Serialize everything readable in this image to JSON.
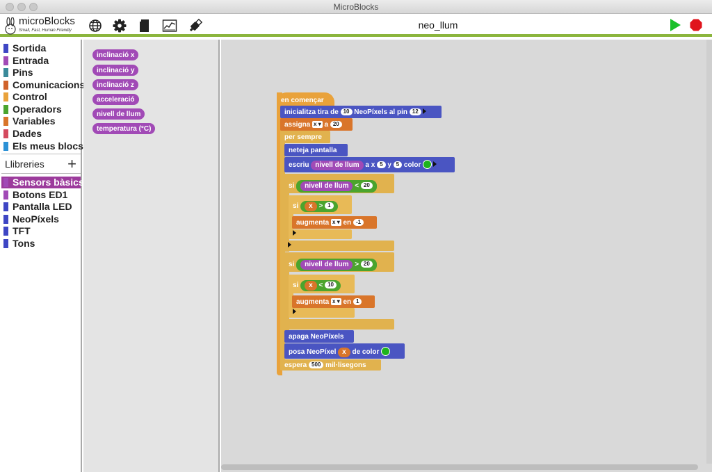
{
  "window": {
    "title": "MicroBlocks"
  },
  "toolbar": {
    "logo_text": "microBlocks",
    "tagline": "Small, Fast, Human Friendly",
    "project_name": "neo_llum",
    "icons": [
      "globe-icon",
      "gear-icon",
      "file-icon",
      "graph-icon",
      "usb-icon"
    ]
  },
  "categories": [
    {
      "label": "Sortida",
      "color": "#3e46c4"
    },
    {
      "label": "Entrada",
      "color": "#a14ab6"
    },
    {
      "label": "Pins",
      "color": "#3a8a9a"
    },
    {
      "label": "Comunicacions",
      "color": "#d0622a"
    },
    {
      "label": "Control",
      "color": "#e9a23b"
    },
    {
      "label": "Operadors",
      "color": "#4ba42d"
    },
    {
      "label": "Variables",
      "color": "#d9752a"
    },
    {
      "label": "Dades",
      "color": "#d44a5f"
    },
    {
      "label": "Els meus blocs",
      "color": "#2b91d6"
    }
  ],
  "libraries": {
    "header": "Llibreries",
    "add": "+",
    "items": [
      {
        "label": "Sensors bàsics",
        "color": "#a14ab6",
        "selected": true
      },
      {
        "label": "Botons ED1",
        "color": "#a14ab6"
      },
      {
        "label": "Pantalla LED",
        "color": "#3e46c4"
      },
      {
        "label": "NeoPíxels",
        "color": "#3e46c4"
      },
      {
        "label": "TFT",
        "color": "#3e46c4"
      },
      {
        "label": "Tons",
        "color": "#3e46c4"
      }
    ]
  },
  "palette_blocks": [
    "inclinació x",
    "inclinació y",
    "inclinació z",
    "acceleració",
    "nivell de llum",
    "temperatura (°C)"
  ],
  "script": {
    "hat": "en començar",
    "init_a": "inicialitza tira de",
    "init_n": "10",
    "init_b": "NeoPíxels al pin",
    "init_pin": "12",
    "assign": "assigna",
    "assign_var": "x",
    "assign_to": "a",
    "assign_val": "20",
    "forever": "per sempre",
    "clear": "neteja pantalla",
    "write": "escriu",
    "write_arg": "nivell de llum",
    "write_ax": "a x",
    "write_x": "5",
    "write_ay": "y",
    "write_y": "5",
    "write_color": "color",
    "if1": "si",
    "if1_rep": "nivell de llum",
    "if1_op": "<",
    "if1_val": "20",
    "if1a": "si",
    "if1a_var": "x",
    "if1a_op": ">",
    "if1a_val": "1",
    "inc1": "augmenta",
    "inc1_var": "x",
    "inc1_by": "en",
    "inc1_val": "-1",
    "if2": "si",
    "if2_rep": "nivell de llum",
    "if2_op": ">",
    "if2_val": "20",
    "if2a": "si",
    "if2a_var": "x",
    "if2a_op": "<",
    "if2a_val": "10",
    "inc2": "augmenta",
    "inc2_var": "x",
    "inc2_by": "en",
    "inc2_val": "1",
    "off": "apaga NeoPíxels",
    "set": "posa NeoPíxel",
    "set_var": "x",
    "set_color": "de color",
    "wait": "espera",
    "wait_val": "500",
    "wait_unit": "mil·lisegons"
  }
}
